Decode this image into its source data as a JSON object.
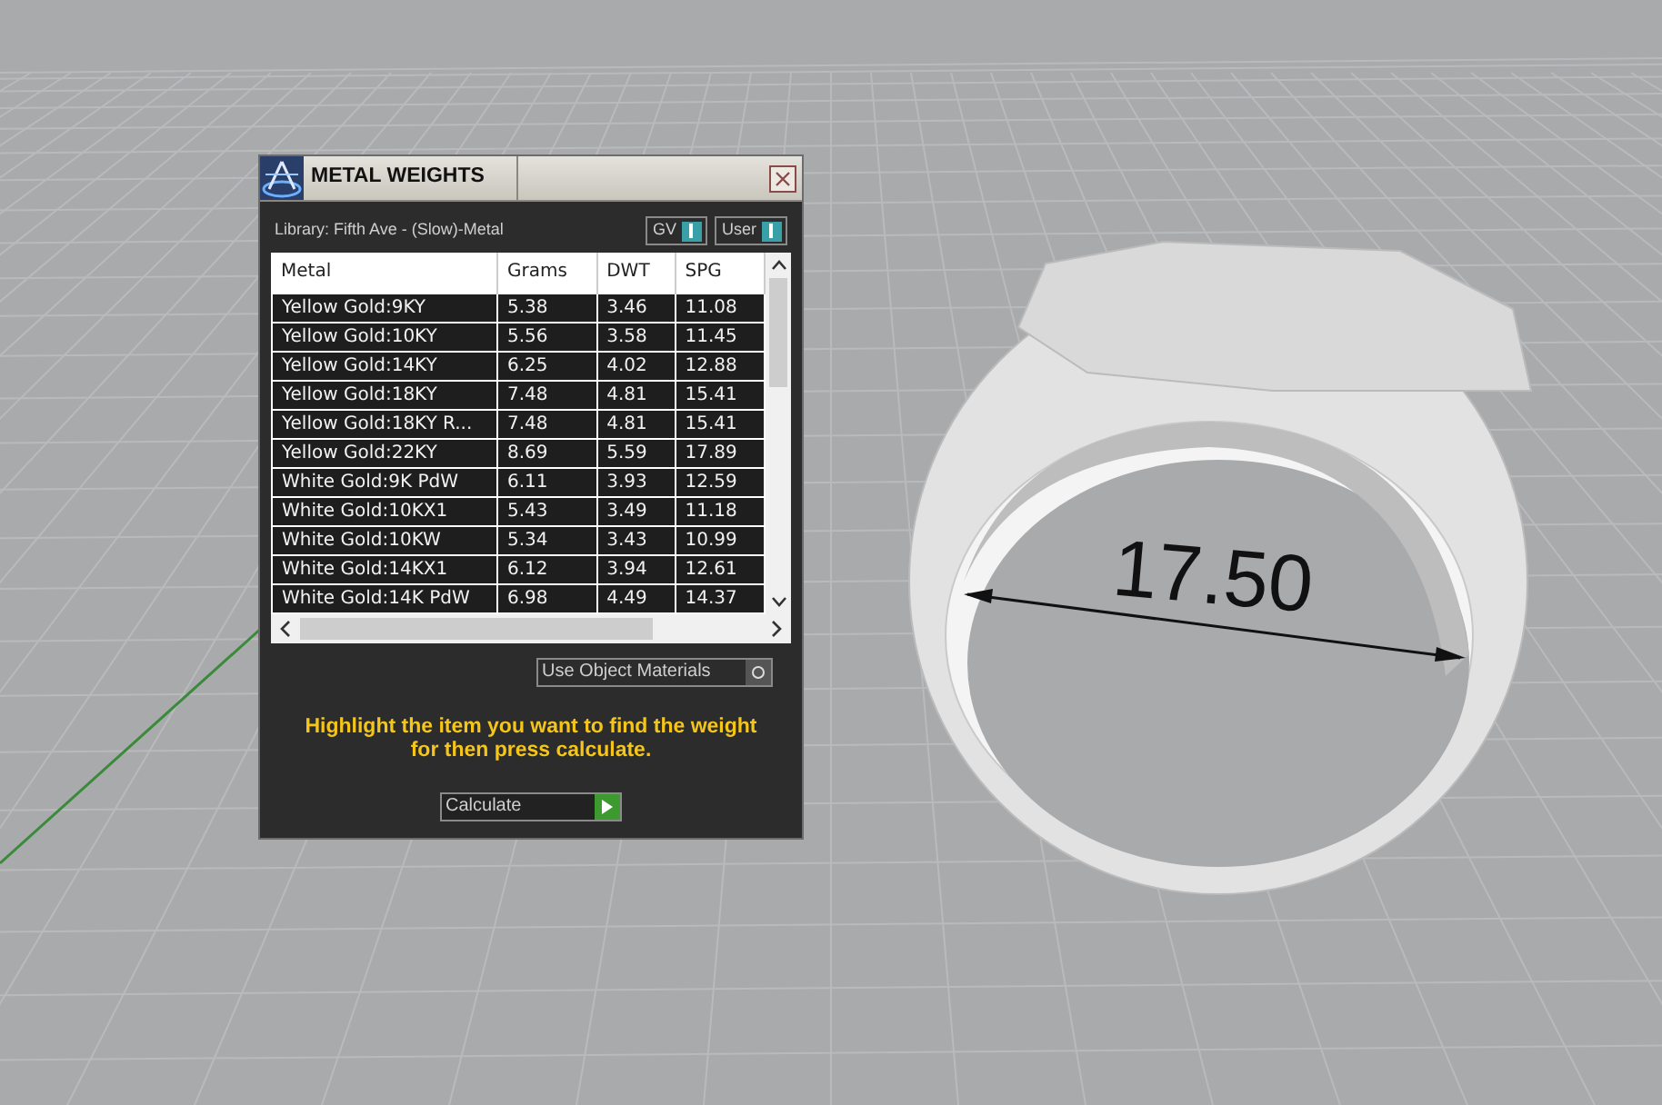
{
  "viewport": {
    "dimension": "17.50"
  },
  "window": {
    "title": "METAL WEIGHTS",
    "library": "Library: Fifth Ave - (Slow)-Metal",
    "toggles": [
      {
        "label": "GV",
        "on": true
      },
      {
        "label": "User",
        "on": true
      }
    ],
    "table": {
      "columns": [
        "Metal",
        "Grams",
        "DWT",
        "SPG"
      ],
      "rows": [
        [
          "Yellow Gold:9KY",
          "5.38",
          "3.46",
          "11.08"
        ],
        [
          "Yellow Gold:10KY",
          "5.56",
          "3.58",
          "11.45"
        ],
        [
          "Yellow Gold:14KY",
          "6.25",
          "4.02",
          "12.88"
        ],
        [
          "Yellow Gold:18KY",
          "7.48",
          "4.81",
          "15.41"
        ],
        [
          "Yellow Gold:18KY R...",
          "7.48",
          "4.81",
          "15.41"
        ],
        [
          "Yellow Gold:22KY",
          "8.69",
          "5.59",
          "17.89"
        ],
        [
          "White Gold:9K PdW",
          "6.11",
          "3.93",
          "12.59"
        ],
        [
          "White Gold:10KX1",
          "5.43",
          "3.49",
          "11.18"
        ],
        [
          "White Gold:10KW",
          "5.34",
          "3.43",
          "10.99"
        ],
        [
          "White Gold:14KX1",
          "6.12",
          "3.94",
          "12.61"
        ],
        [
          "White Gold:14K PdW",
          "6.98",
          "4.49",
          "14.37"
        ]
      ]
    },
    "use_object_materials": {
      "label": "Use Object Materials",
      "on": false
    },
    "hint": "Highlight the item you want to find the weight for then press calculate.",
    "calculate_button": "Calculate"
  }
}
